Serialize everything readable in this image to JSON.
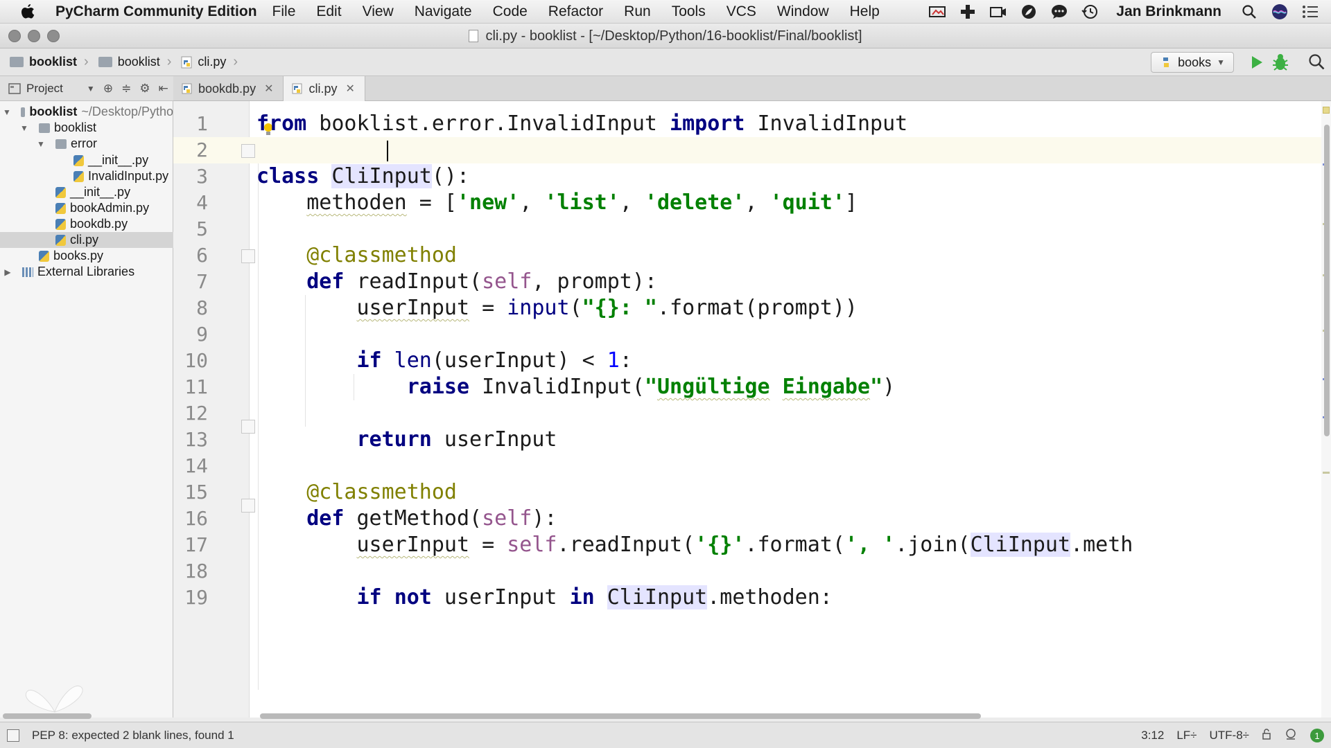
{
  "menubar": {
    "app_name": "PyCharm Community Edition",
    "items": [
      "File",
      "Edit",
      "View",
      "Navigate",
      "Code",
      "Refactor",
      "Run",
      "Tools",
      "VCS",
      "Window",
      "Help"
    ],
    "user": "Jan Brinkmann"
  },
  "window": {
    "title": "cli.py - booklist - [~/Desktop/Python/16-booklist/Final/booklist]"
  },
  "breadcrumbs": [
    "booklist",
    "booklist",
    "cli.py"
  ],
  "run_config": {
    "label": "books"
  },
  "project_panel": {
    "label": "Project",
    "tree": [
      {
        "label": "booklist",
        "extra": "~/Desktop/Pytho",
        "level": 0,
        "type": "folder",
        "expanded": true,
        "bold": true
      },
      {
        "label": "booklist",
        "level": 1,
        "type": "folder",
        "expanded": true
      },
      {
        "label": "error",
        "level": 2,
        "type": "folder",
        "expanded": true
      },
      {
        "label": "__init__.py",
        "level": 3,
        "type": "py"
      },
      {
        "label": "InvalidInput.py",
        "level": 3,
        "type": "py"
      },
      {
        "label": "__init__.py",
        "level": 2,
        "type": "py"
      },
      {
        "label": "bookAdmin.py",
        "level": 2,
        "type": "py"
      },
      {
        "label": "bookdb.py",
        "level": 2,
        "type": "py"
      },
      {
        "label": "cli.py",
        "level": 2,
        "type": "py",
        "selected": true
      },
      {
        "label": "books.py",
        "level": 1,
        "type": "py"
      },
      {
        "label": "External Libraries",
        "level": 0,
        "type": "lib",
        "expanded": false
      }
    ]
  },
  "tabs": [
    {
      "label": "bookdb.py",
      "active": false
    },
    {
      "label": "cli.py",
      "active": true
    }
  ],
  "editor": {
    "line_numbers": [
      "1",
      "2",
      "3",
      "4",
      "5",
      "6",
      "7",
      "8",
      "9",
      "10",
      "11",
      "12",
      "13",
      "14",
      "15",
      "16",
      "17",
      "18",
      "19"
    ],
    "code": {
      "l1_from": "from",
      "l1_module": " booklist.error.InvalidInput ",
      "l1_import": "import",
      "l1_name": " InvalidInput",
      "l3_class": "class",
      "l3_space": " ",
      "l3_name": "CliInput",
      "l3_rest": "():",
      "l4_indent": "    ",
      "l4_var": "methoden",
      "l4_eq": " = [",
      "l4_s1": "'new'",
      "l4_c1": ", ",
      "l4_s2": "'list'",
      "l4_c2": ", ",
      "l4_s3": "'delete'",
      "l4_c3": ", ",
      "l4_s4": "'quit'",
      "l4_end": "]",
      "l6_deco": "    @classmethod",
      "l7_indent": "    ",
      "l7_def": "def",
      "l7_name": " readInput(",
      "l7_self": "self",
      "l7_rest": ", prompt):",
      "l8_indent": "        ",
      "l8_var": "userInput",
      "l8_eq": " = ",
      "l8_fn": "input",
      "l8_open": "(",
      "l8_str": "\"{}: \"",
      "l8_rest": ".format(prompt))",
      "l10_indent": "        ",
      "l10_if": "if",
      "l10_len": " len",
      "l10_mid": "(userInput) < ",
      "l10_num": "1",
      "l10_end": ":",
      "l11_indent": "            ",
      "l11_raise": "raise",
      "l11_mid": " InvalidInput(",
      "l11_q1": "\"",
      "l11_w1": "Ungültige",
      "l11_sp": " ",
      "l11_w2": "Eingabe",
      "l11_q2": "\"",
      "l11_end": ")",
      "l13_indent": "        ",
      "l13_return": "return",
      "l13_rest": " userInput",
      "l15_deco": "    @classmethod",
      "l16_indent": "    ",
      "l16_def": "def",
      "l16_name": " getMethod(",
      "l16_self": "self",
      "l16_rest": "):",
      "l17_indent": "        ",
      "l17_var": "userInput",
      "l17_eq": " = ",
      "l17_self": "self",
      "l17_mid": ".readInput(",
      "l17_s1": "'{}'",
      "l17_fmt": ".format(",
      "l17_s2": "', '",
      "l17_join": ".join(",
      "l17_cls": "CliInput",
      "l17_end": ".meth",
      "l19_indent": "        ",
      "l19_if": "if",
      "l19_sp": " ",
      "l19_not": "not",
      "l19_mid": " userInput ",
      "l19_in": "in",
      "l19_sp2": " ",
      "l19_cls": "CliInput",
      "l19_end": ".methoden:"
    }
  },
  "statusbar": {
    "message": "PEP 8: expected 2 blank lines, found 1",
    "position": "3:12",
    "line_sep": "LF÷",
    "encoding": "UTF-8÷",
    "notifications": "1"
  },
  "colors": {
    "keyword": "#000080",
    "string": "#008000",
    "decorator": "#808000",
    "self": "#94558d",
    "current_line": "#fcfaed",
    "run_green": "#3cb043"
  }
}
